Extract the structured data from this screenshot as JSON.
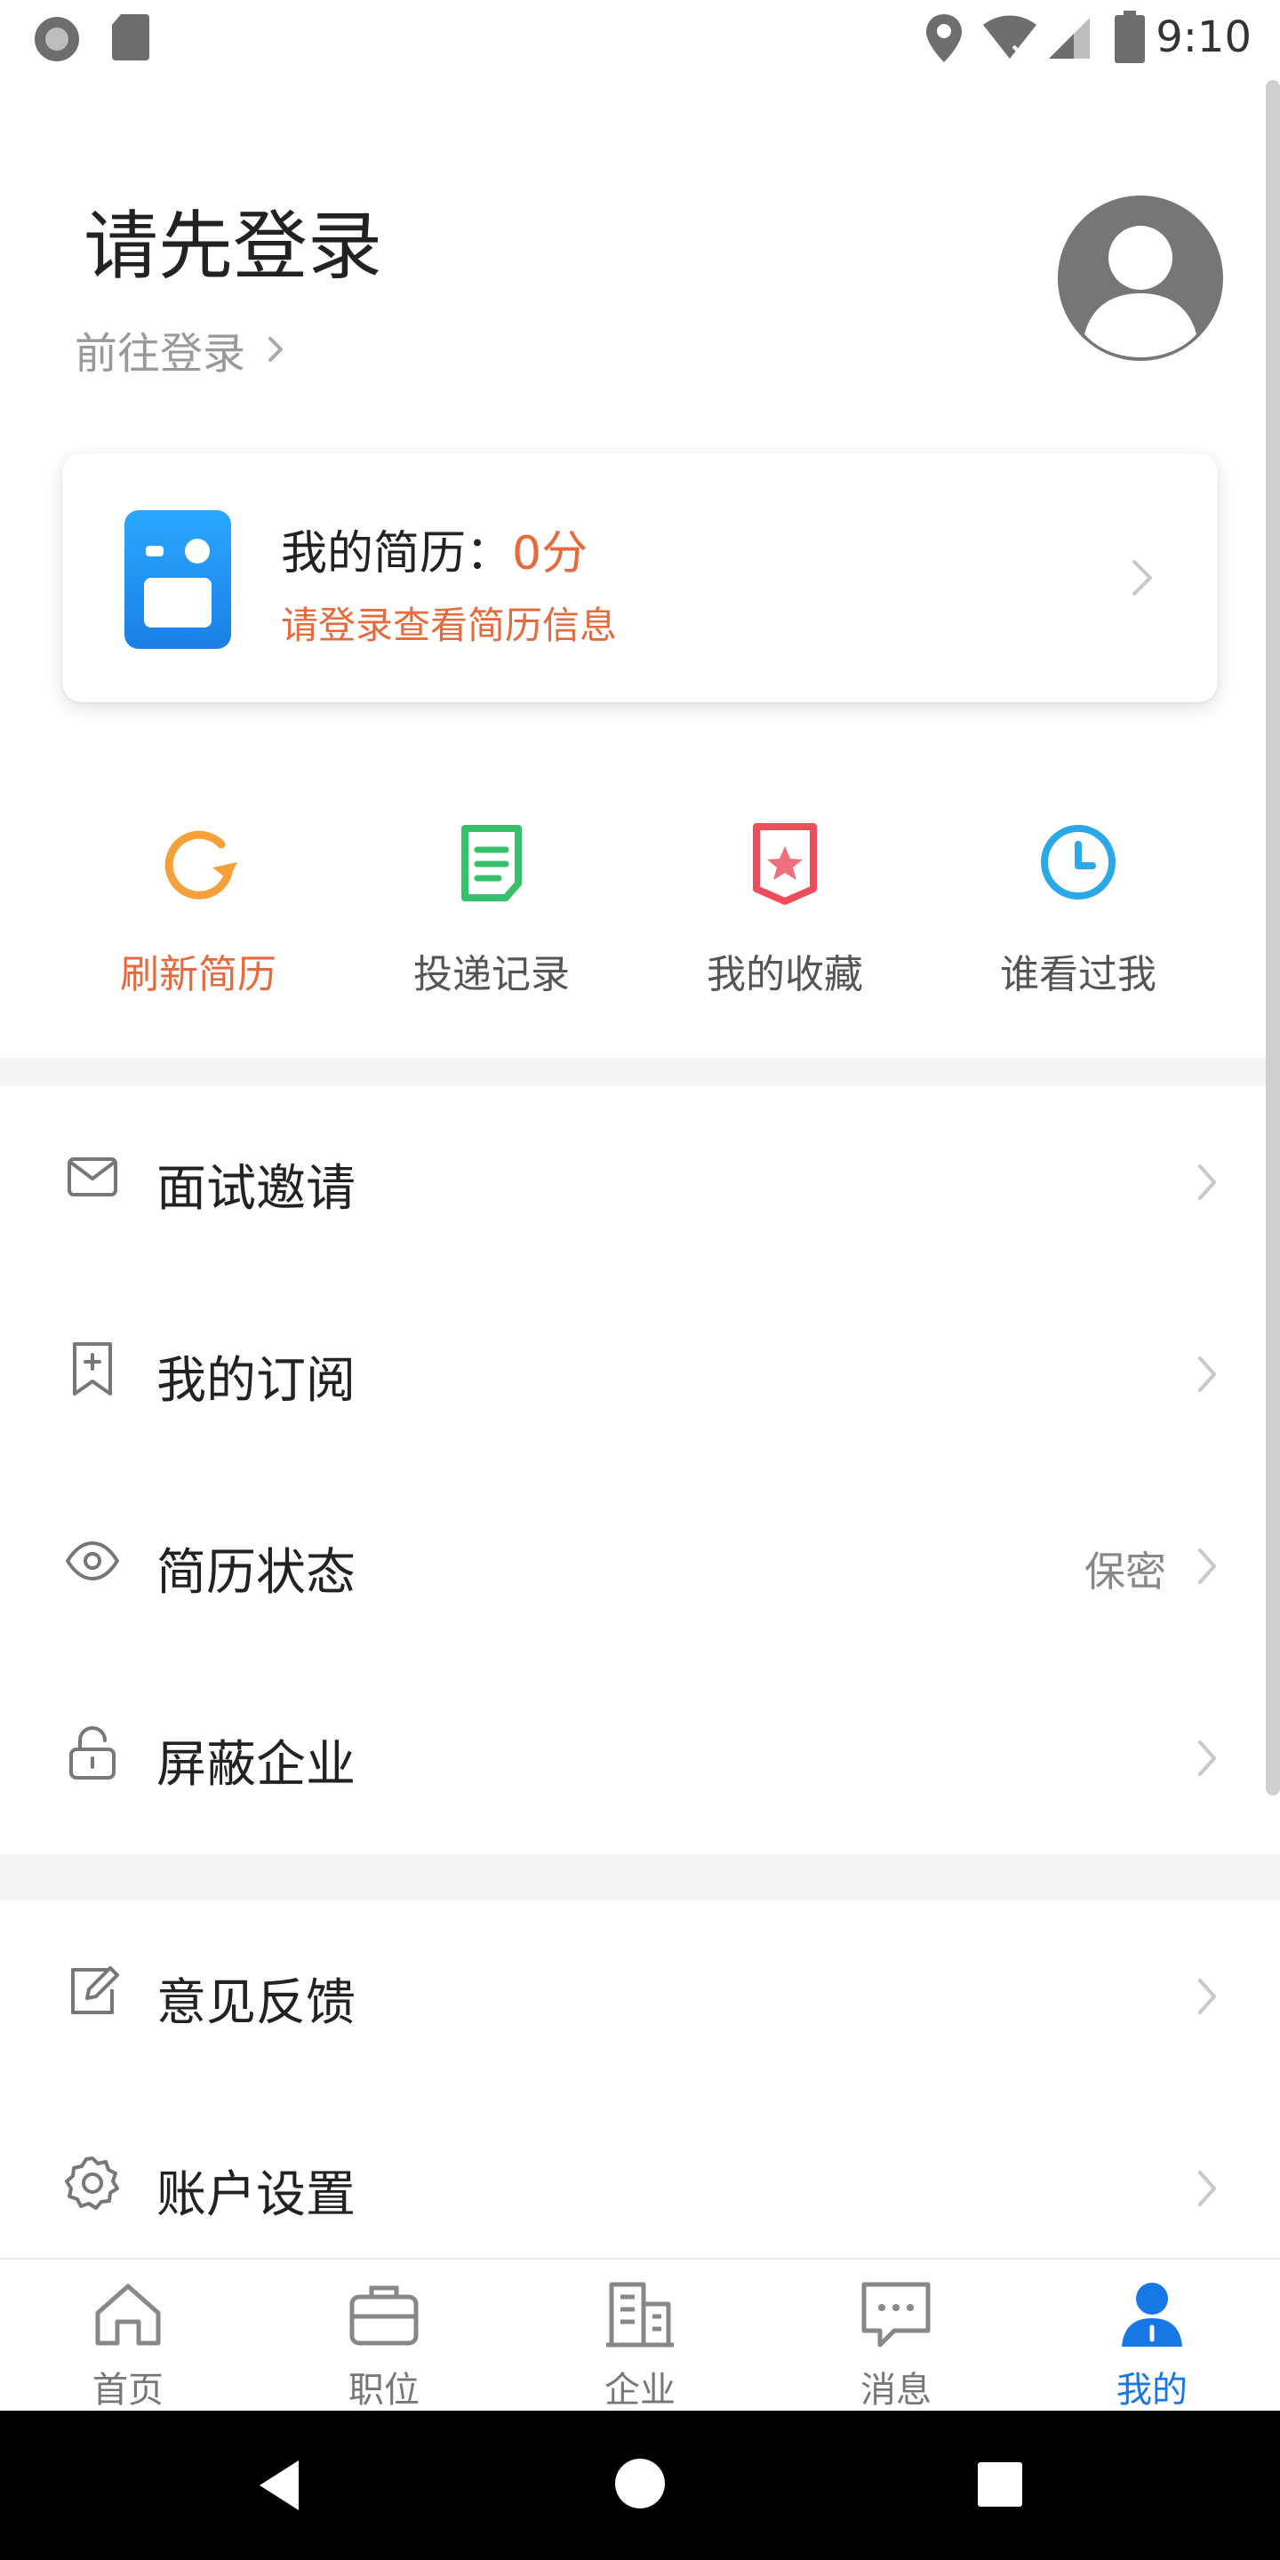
{
  "status_bar": {
    "time": "9:10"
  },
  "header": {
    "title": "请先登录",
    "login_link": "前往登录"
  },
  "resume_card": {
    "title_prefix": "我的简历：",
    "score": "0分",
    "subtitle": "请登录查看简历信息"
  },
  "shortcuts": [
    {
      "label": "刷新简历",
      "icon": "refresh-icon",
      "color": "#f5a03a"
    },
    {
      "label": "投递记录",
      "icon": "document-icon",
      "color": "#36c06b"
    },
    {
      "label": "我的收藏",
      "icon": "bookmark-star-icon",
      "color": "#ef4d5c"
    },
    {
      "label": "谁看过我",
      "icon": "clock-icon",
      "color": "#2aa8e8"
    }
  ],
  "menu": {
    "interview": {
      "label": "面试邀请",
      "icon": "mail-icon"
    },
    "subscription": {
      "label": "我的订阅",
      "icon": "bookmark-plus-icon"
    },
    "resume_status": {
      "label": "简历状态",
      "value": "保密",
      "icon": "eye-icon"
    },
    "block": {
      "label": "屏蔽企业",
      "icon": "lock-icon"
    },
    "feedback": {
      "label": "意见反馈",
      "icon": "edit-icon"
    },
    "settings": {
      "label": "账户设置",
      "icon": "gear-icon"
    }
  },
  "bottom_nav": [
    {
      "label": "首页",
      "icon": "home-icon"
    },
    {
      "label": "职位",
      "icon": "briefcase-icon"
    },
    {
      "label": "企业",
      "icon": "building-icon"
    },
    {
      "label": "消息",
      "icon": "chat-icon"
    },
    {
      "label": "我的",
      "icon": "user-icon",
      "active": true
    }
  ],
  "colors": {
    "accent": "#e76a3c",
    "active": "#1677e5"
  }
}
